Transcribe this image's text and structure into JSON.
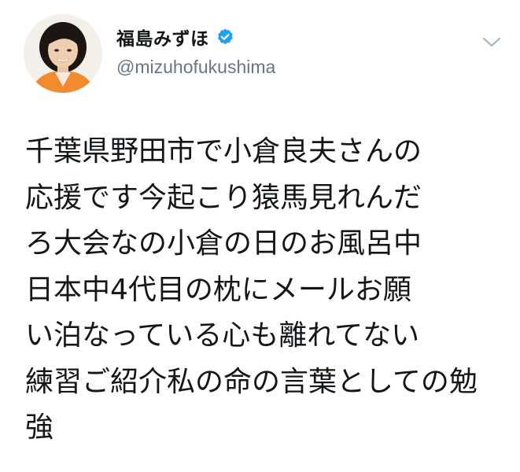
{
  "tweet": {
    "author": {
      "display_name": "福島みずほ",
      "handle": "@mizuhofukushima",
      "verified": true,
      "verified_icon": "verified-badge-icon",
      "avatar_icon": "profile-photo"
    },
    "menu_icon": "chevron-down-icon",
    "text": "千葉県野田市で小倉良夫さんの\n応援です今起こり猿馬見れんだ\nろ大会なの小倉の日のお風呂中\n日本中4代目の枕にメールお願\nい泊なっている心も離れてない\n練習ご紹介私の命の言葉としての勉強"
  },
  "colors": {
    "text": "#14171a",
    "secondary": "#657786",
    "verified_blue": "#1da1f2",
    "background": "#ffffff"
  }
}
